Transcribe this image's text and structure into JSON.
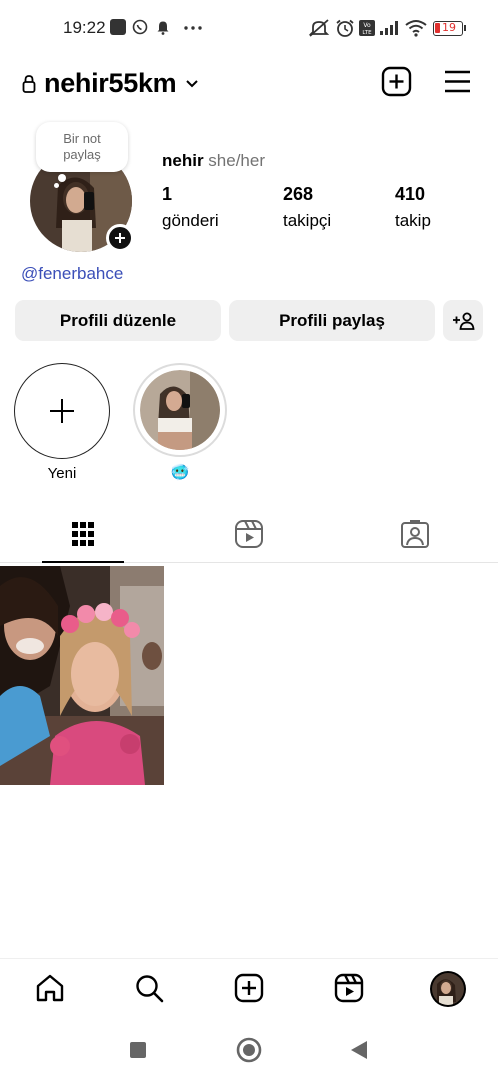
{
  "status_bar": {
    "time": "19:22",
    "battery": "19"
  },
  "header": {
    "username": "nehir55km"
  },
  "profile": {
    "note_text": "Bir not paylaş",
    "name": "nehir",
    "pronouns": "she/her",
    "stats": [
      {
        "value": "1",
        "label": "gönderi"
      },
      {
        "value": "268",
        "label": "takipçi"
      },
      {
        "value": "410",
        "label": "takip"
      }
    ],
    "link": "@fenerbahce"
  },
  "buttons": {
    "edit_profile": "Profili düzenle",
    "share_profile": "Profili paylaş"
  },
  "highlights": [
    {
      "label": "Yeni"
    },
    {
      "label": "🥶"
    }
  ],
  "tabs": [
    "grid-icon",
    "reels-icon",
    "tagged-icon"
  ],
  "bottom_nav": [
    "home-icon",
    "search-icon",
    "create-icon",
    "reels-icon",
    "profile-avatar"
  ],
  "colors": {
    "link": "#3b4fb8",
    "button_bg": "#efefef",
    "battery_low": "#e0312f"
  }
}
